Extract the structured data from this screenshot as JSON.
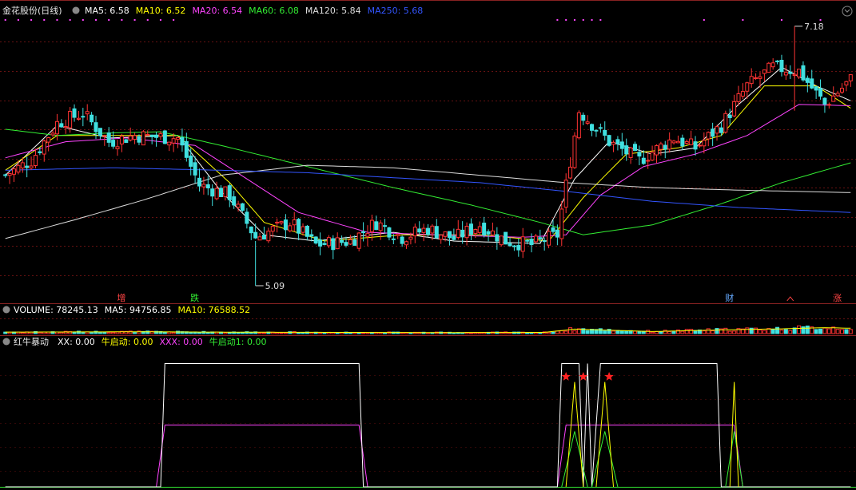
{
  "price_panel": {
    "stock_name": "金花股份(日线)",
    "ma_labels": [
      {
        "text": "MA5: 6.58",
        "color": "#ffffff"
      },
      {
        "text": "MA10: 6.52",
        "color": "#ffff00"
      },
      {
        "text": "MA20: 6.54",
        "color": "#ff44ff"
      },
      {
        "text": "MA60: 6.08",
        "color": "#33ee33"
      },
      {
        "text": "MA120: 5.84",
        "color": "#dddddd"
      },
      {
        "text": "MA250: 5.68",
        "color": "#3355ff"
      }
    ],
    "high_label": "7.18",
    "low_label": "5.09",
    "markers": [
      {
        "text": "增",
        "color": "#ff4444",
        "day": 27
      },
      {
        "text": "跌",
        "color": "#33ee33",
        "day": 44
      },
      {
        "text": "财",
        "color": "#66aaff",
        "day": 168
      },
      {
        "text": "涨",
        "color": "#ff4444",
        "day": 193
      }
    ]
  },
  "volume_panel": {
    "labels": [
      {
        "text": "VOLUME: 78245.13",
        "color": "#ffffff"
      },
      {
        "text": "MA5: 94756.85",
        "color": "#ffffff"
      },
      {
        "text": "MA10: 76588.52",
        "color": "#ffff00"
      }
    ]
  },
  "indicator_panel": {
    "name": "红牛暴动",
    "labels": [
      {
        "text": "XX: 0.00",
        "color": "#ffffff"
      },
      {
        "text": "牛启动: 0.00",
        "color": "#ffff00"
      },
      {
        "text": "XXX: 0.00",
        "color": "#ff44ff"
      },
      {
        "text": "牛启动1: 0.00",
        "color": "#33ee33"
      }
    ]
  },
  "colors": {
    "up": "#ff3333",
    "down": "#40e0e0",
    "background": "#000000",
    "grid": "#661111"
  },
  "chart_data": {
    "type": "candlestick",
    "y_range": [
      5.0,
      7.25
    ],
    "days": 197,
    "price_anchors": [
      [
        0,
        5.98
      ],
      [
        6,
        6.1
      ],
      [
        12,
        6.4
      ],
      [
        18,
        6.48
      ],
      [
        24,
        6.25
      ],
      [
        30,
        6.3
      ],
      [
        40,
        6.28
      ],
      [
        45,
        5.9
      ],
      [
        52,
        5.82
      ],
      [
        58,
        5.48
      ],
      [
        66,
        5.6
      ],
      [
        72,
        5.42
      ],
      [
        80,
        5.45
      ],
      [
        86,
        5.6
      ],
      [
        92,
        5.48
      ],
      [
        98,
        5.55
      ],
      [
        104,
        5.47
      ],
      [
        110,
        5.58
      ],
      [
        116,
        5.45
      ],
      [
        122,
        5.42
      ],
      [
        128,
        5.5
      ],
      [
        133,
        6.5
      ],
      [
        140,
        6.25
      ],
      [
        147,
        6.1
      ],
      [
        155,
        6.28
      ],
      [
        160,
        6.2
      ],
      [
        166,
        6.38
      ],
      [
        172,
        6.7
      ],
      [
        178,
        6.85
      ],
      [
        184,
        6.82
      ],
      [
        190,
        6.55
      ],
      [
        196,
        6.75
      ]
    ],
    "ma_anchors": {
      "MA5": [
        [
          0,
          5.98
        ],
        [
          12,
          6.38
        ],
        [
          24,
          6.28
        ],
        [
          40,
          6.3
        ],
        [
          50,
          5.85
        ],
        [
          60,
          5.5
        ],
        [
          72,
          5.45
        ],
        [
          90,
          5.52
        ],
        [
          104,
          5.45
        ],
        [
          124,
          5.43
        ],
        [
          132,
          5.95
        ],
        [
          140,
          6.25
        ],
        [
          150,
          6.15
        ],
        [
          160,
          6.2
        ],
        [
          170,
          6.55
        ],
        [
          180,
          6.85
        ],
        [
          188,
          6.7
        ],
        [
          196,
          6.58
        ]
      ],
      "MA10": [
        [
          0,
          6.02
        ],
        [
          12,
          6.3
        ],
        [
          24,
          6.3
        ],
        [
          40,
          6.3
        ],
        [
          52,
          5.92
        ],
        [
          60,
          5.6
        ],
        [
          74,
          5.45
        ],
        [
          92,
          5.5
        ],
        [
          110,
          5.5
        ],
        [
          126,
          5.45
        ],
        [
          134,
          5.8
        ],
        [
          144,
          6.15
        ],
        [
          156,
          6.2
        ],
        [
          166,
          6.3
        ],
        [
          176,
          6.7
        ],
        [
          188,
          6.7
        ],
        [
          196,
          6.52
        ]
      ],
      "MA20": [
        [
          0,
          6.12
        ],
        [
          14,
          6.25
        ],
        [
          28,
          6.28
        ],
        [
          44,
          6.22
        ],
        [
          56,
          5.95
        ],
        [
          68,
          5.68
        ],
        [
          84,
          5.52
        ],
        [
          100,
          5.5
        ],
        [
          120,
          5.48
        ],
        [
          130,
          5.5
        ],
        [
          138,
          5.82
        ],
        [
          148,
          6.05
        ],
        [
          160,
          6.15
        ],
        [
          172,
          6.3
        ],
        [
          184,
          6.55
        ],
        [
          196,
          6.54
        ]
      ],
      "MA60": [
        [
          0,
          6.35
        ],
        [
          12,
          6.3
        ],
        [
          24,
          6.32
        ],
        [
          36,
          6.33
        ],
        [
          50,
          6.22
        ],
        [
          70,
          6.05
        ],
        [
          90,
          5.88
        ],
        [
          108,
          5.74
        ],
        [
          124,
          5.6
        ],
        [
          134,
          5.5
        ],
        [
          150,
          5.58
        ],
        [
          166,
          5.75
        ],
        [
          180,
          5.92
        ],
        [
          196,
          6.08
        ]
      ],
      "MA120": [
        [
          0,
          5.47
        ],
        [
          16,
          5.62
        ],
        [
          32,
          5.78
        ],
        [
          50,
          5.98
        ],
        [
          70,
          6.06
        ],
        [
          90,
          6.04
        ],
        [
          110,
          5.98
        ],
        [
          130,
          5.92
        ],
        [
          150,
          5.88
        ],
        [
          170,
          5.86
        ],
        [
          196,
          5.84
        ]
      ],
      "MA250": [
        [
          0,
          6.02
        ],
        [
          25,
          6.04
        ],
        [
          50,
          6.02
        ],
        [
          70,
          6.0
        ],
        [
          90,
          5.96
        ],
        [
          110,
          5.92
        ],
        [
          130,
          5.85
        ],
        [
          150,
          5.77
        ],
        [
          170,
          5.72
        ],
        [
          196,
          5.68
        ]
      ]
    },
    "volume_range": [
      0,
      700000
    ],
    "volume_anchors": [
      [
        0,
        50000
      ],
      [
        30,
        60000
      ],
      [
        60,
        45000
      ],
      [
        100,
        35000
      ],
      [
        125,
        40000
      ],
      [
        132,
        150000
      ],
      [
        150,
        70000
      ],
      [
        168,
        130000
      ],
      [
        180,
        160000
      ],
      [
        190,
        200000
      ],
      [
        196,
        180000
      ]
    ],
    "indicator": {
      "y_range": [
        0,
        1.1
      ],
      "XX": [
        [
          0,
          0
        ],
        [
          36,
          0
        ],
        [
          37,
          1
        ],
        [
          82,
          1
        ],
        [
          83,
          0
        ],
        [
          128,
          0
        ],
        [
          129,
          1
        ],
        [
          133,
          1
        ],
        [
          134,
          0
        ],
        [
          135,
          1
        ],
        [
          136,
          0
        ],
        [
          138,
          1
        ],
        [
          165,
          1
        ],
        [
          166,
          0
        ],
        [
          196,
          0
        ]
      ],
      "XXX": [
        [
          0,
          0
        ],
        [
          35,
          0
        ],
        [
          37,
          0.5
        ],
        [
          82,
          0.5
        ],
        [
          84,
          0
        ],
        [
          128,
          0
        ],
        [
          130,
          0.5
        ],
        [
          169,
          0.5
        ],
        [
          171,
          0
        ],
        [
          196,
          0
        ]
      ],
      "star_days": [
        130,
        134,
        140
      ]
    }
  }
}
